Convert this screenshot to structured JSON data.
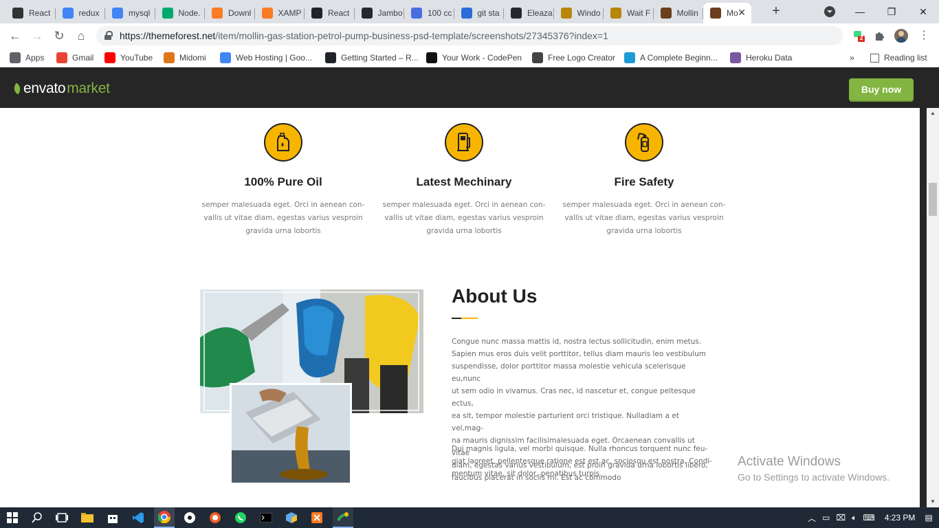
{
  "browser": {
    "tabs": [
      {
        "label": "React",
        "icon": "z-icon",
        "color": "#333333"
      },
      {
        "label": "redux",
        "icon": "google-icon",
        "color": "#4285f4"
      },
      {
        "label": "mysql",
        "icon": "google-icon",
        "color": "#4285f4"
      },
      {
        "label": "Node.",
        "icon": "w3-icon",
        "color": "#04aa6d"
      },
      {
        "label": "Downl",
        "icon": "xampp-icon",
        "color": "#fb7a24"
      },
      {
        "label": "XAMP",
        "icon": "xampp-icon",
        "color": "#fb7a24"
      },
      {
        "label": "React",
        "icon": "react-icon",
        "color": "#20232a"
      },
      {
        "label": "Jambo",
        "icon": "github-icon",
        "color": "#24292e"
      },
      {
        "label": "100 cc",
        "icon": "c-icon",
        "color": "#4a6ee0"
      },
      {
        "label": "git sta",
        "icon": "a-icon",
        "color": "#2c6cd6"
      },
      {
        "label": "Eleaza",
        "icon": "github-icon",
        "color": "#24292e"
      },
      {
        "label": "Windo",
        "icon": "g-icon",
        "color": "#b8860b"
      },
      {
        "label": "Wait F",
        "icon": "g-icon",
        "color": "#b8860b"
      },
      {
        "label": "Mollin",
        "icon": "mollin-icon",
        "color": "#6b3e1e"
      },
      {
        "label": "Mo",
        "icon": "mollin-icon",
        "color": "#6b3e1e",
        "active": true
      }
    ],
    "new_tab": "+",
    "window_controls": {
      "minimize": "—",
      "restore": "❐",
      "close": "✕"
    },
    "url_host": "https://themeforest.net",
    "url_path": "/item/mollin-gas-station-petrol-pump-business-psd-template/screenshots/27345376?index=1",
    "extension_badge": "2",
    "bookmarks": [
      {
        "label": "Apps",
        "icon": "apps-icon",
        "color": "#5f6368"
      },
      {
        "label": "Gmail",
        "icon": "gmail-icon",
        "color": "#ea4335"
      },
      {
        "label": "YouTube",
        "icon": "youtube-icon",
        "color": "#ff0000"
      },
      {
        "label": "Midomi",
        "icon": "midomi-icon",
        "color": "#e0761a"
      },
      {
        "label": "Web Hosting | Goo...",
        "icon": "gcloud-icon",
        "color": "#4285f4"
      },
      {
        "label": "Getting Started – R...",
        "icon": "react-icon",
        "color": "#20232a"
      },
      {
        "label": "Your Work - CodePen",
        "icon": "codepen-icon",
        "color": "#111111"
      },
      {
        "label": "Free Logo Creator",
        "icon": "logo-creator-icon",
        "color": "#444444"
      },
      {
        "label": "A Complete Beginn...",
        "icon": "s-icon",
        "color": "#1e9bd7"
      },
      {
        "label": "Heroku Data",
        "icon": "heroku-icon",
        "color": "#79589f"
      }
    ],
    "overflow": "»",
    "reading_list": "Reading list"
  },
  "envato": {
    "logo_main": "envato",
    "logo_sub": "market",
    "buy_now": "Buy now",
    "brand_green": "#82b541"
  },
  "features": [
    {
      "title": "100% Pure Oil",
      "icon": "oil-can-icon",
      "desc_1": "semper malesuada eget. Orci in aenean con-",
      "desc_2": "vallis ut vitae diam, egestas varius vesproin",
      "desc_3": "gravida urna lobortis"
    },
    {
      "title": "Latest Mechinary",
      "icon": "fuel-pump-icon",
      "desc_1": "semper malesuada eget. Orci in aenean con-",
      "desc_2": "vallis ut vitae diam, egestas varius vesproin",
      "desc_3": "gravida urna lobortis"
    },
    {
      "title": "Fire Safety",
      "icon": "fire-extinguisher-icon",
      "desc_1": "semper malesuada eget. Orci in aenean con-",
      "desc_2": "vallis ut vitae diam, egestas varius vesproin",
      "desc_3": "gravida urna lobortis"
    }
  ],
  "accent_color": "#f7b500",
  "about": {
    "title": "About Us",
    "p1": [
      "Congue nunc massa mattis id, nostra lectus sollicitudin, enim metus.",
      "Sapien mus eros duis velit porttitor, tellus diam mauris leo vestibulum",
      "suspendisse, dolor porttitor massa molestie vehicula scelerisque eu,nunc",
      "ut sem odio in vivamus. Cras nec, id nascetur et, congue peltesque ectus,",
      "ea sit, tempor molestie parturient orci tristique. Nulladiam a et vel,mag-",
      "na mauris dignissim facilisimalesuada eget. Orcaenean convallis ut vitae",
      "diam, egestas varius vestibulum, est proin gravida urna lobortis libero,",
      "faucibus placerat in sociis mi. Est ac commodo"
    ],
    "p2": [
      "Dui magnis ligula, vel morbi quisque. Nulla rhoncus torquent nunc feu-",
      "giat laoreet, pellentesque ratione est est ac, sociosqu est nostra. Condi-",
      "mentum vitae, sit dolor, penatibus turpis."
    ]
  },
  "watermark": {
    "line1": "Activate Windows",
    "line2": "Go to Settings to activate Windows."
  },
  "taskbar": {
    "time": "4:23 PM"
  }
}
